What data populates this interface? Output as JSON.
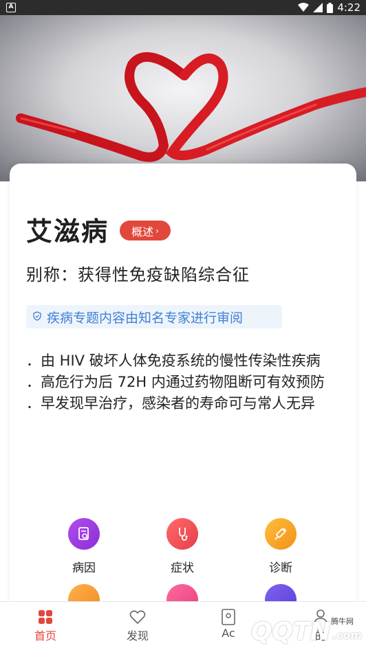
{
  "status_bar": {
    "time": "4:22"
  },
  "disease": {
    "name": "艾滋病",
    "overview_label": "概述",
    "alias": "别称：获得性免疫缺陷综合征",
    "review_note": "疾病专题内容由知名专家进行审阅",
    "bullets": [
      "．由 HIV 破坏人体免疫系统的慢性传染性疾病",
      "．高危行为后 72H 内通过药物阻断可有效预防",
      "．早发现早治疗，感染者的寿命可与常人无异"
    ]
  },
  "grid": {
    "items": [
      {
        "label": "病因",
        "icon": "document-search-icon",
        "color": "#9b3fe0"
      },
      {
        "label": "症状",
        "icon": "stethoscope-icon",
        "color": "#f0525a"
      },
      {
        "label": "诊断",
        "icon": "syringe-icon",
        "color": "#f6a21c"
      }
    ],
    "partial_row_colors": [
      "#f59a33",
      "#f0508a",
      "#6a4fe0"
    ]
  },
  "tab_bar": {
    "tabs": [
      {
        "label": "首页",
        "icon": "home-grid-icon",
        "active": true
      },
      {
        "label": "发现",
        "icon": "heart-icon",
        "active": false
      },
      {
        "label": "Ac",
        "icon": "contacts-icon",
        "active": false
      },
      {
        "label": "的",
        "icon": "person-icon",
        "active": false
      }
    ]
  },
  "watermark": {
    "brand": "QQTN",
    "suffix": ".com",
    "cn_name": "腾牛网"
  },
  "colors": {
    "accent": "#e2473b",
    "review_blue": "#3f7fd6",
    "review_bg": "#eef4fb"
  }
}
